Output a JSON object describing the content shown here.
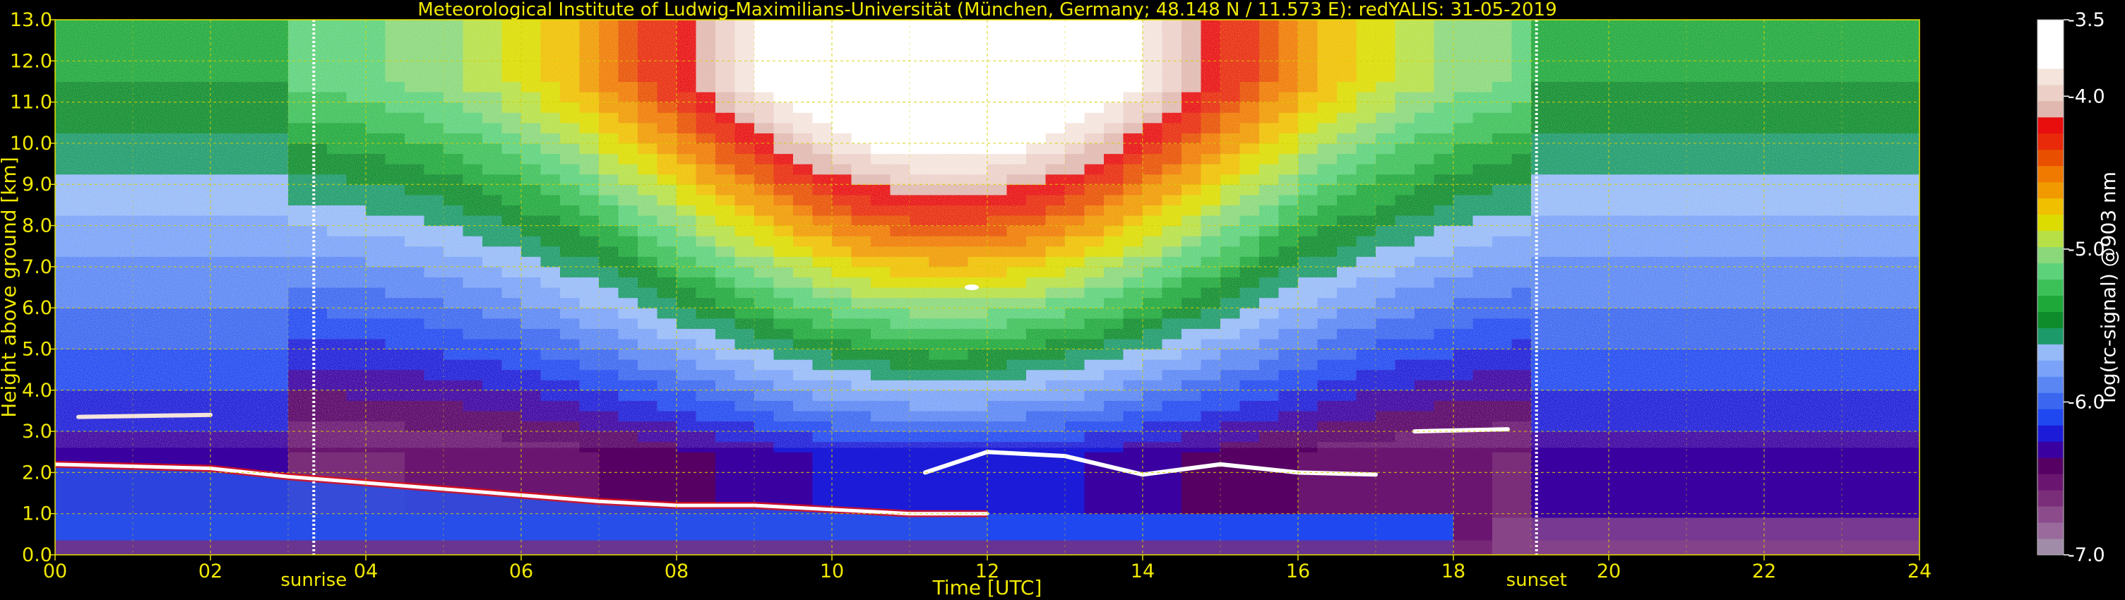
{
  "chart_data": {
    "type": "heatmap",
    "title": "Meteorological Institute of Ludwig-Maximilians-Universität (München, Germany; 48.148 N / 11.573 E):    redYALIS: 31-05-2019",
    "xlabel": "Time [UTC]",
    "ylabel": "Height above ground [km]",
    "xlim": [
      0,
      24
    ],
    "ylim": [
      0,
      13
    ],
    "xticks": [
      {
        "value": 0,
        "label": "00"
      },
      {
        "value": 2,
        "label": "02"
      },
      {
        "value": 4,
        "label": "04"
      },
      {
        "value": 6,
        "label": "06"
      },
      {
        "value": 8,
        "label": "08"
      },
      {
        "value": 10,
        "label": "10"
      },
      {
        "value": 12,
        "label": "12"
      },
      {
        "value": 14,
        "label": "14"
      },
      {
        "value": 16,
        "label": "16"
      },
      {
        "value": 18,
        "label": "18"
      },
      {
        "value": 20,
        "label": "20"
      },
      {
        "value": 22,
        "label": "22"
      },
      {
        "value": 24,
        "label": "24"
      }
    ],
    "yticks": [
      {
        "value": 0,
        "label": "0.0"
      },
      {
        "value": 1,
        "label": "1.0"
      },
      {
        "value": 2,
        "label": "2.0"
      },
      {
        "value": 3,
        "label": "3.0"
      },
      {
        "value": 4,
        "label": "4.0"
      },
      {
        "value": 5,
        "label": "5.0"
      },
      {
        "value": 6,
        "label": "6.0"
      },
      {
        "value": 7,
        "label": "7.0"
      },
      {
        "value": 8,
        "label": "8.0"
      },
      {
        "value": 9,
        "label": "9.0"
      },
      {
        "value": 10,
        "label": "10.0"
      },
      {
        "value": 11,
        "label": "11.0"
      },
      {
        "value": 12,
        "label": "12.0"
      },
      {
        "value": 13,
        "label": "13.0"
      }
    ],
    "grid": true,
    "markers": [
      {
        "label": "sunrise",
        "x": 3.33
      },
      {
        "label": "sunset",
        "x": 19.07
      }
    ],
    "colorbar": {
      "label": "log(rc-signal) @903 nm",
      "range": [
        -7.0,
        -3.5
      ],
      "ticks": [
        {
          "value": -3.5,
          "label": "-3.5"
        },
        {
          "value": -4.0,
          "label": "-4.0"
        },
        {
          "value": -5.0,
          "label": "-5.0"
        },
        {
          "value": -6.0,
          "label": "-6.0"
        },
        {
          "value": -7.0,
          "label": "-7.0"
        }
      ],
      "colors": [
        "#a08ca8",
        "#9a6a9c",
        "#8c4c8c",
        "#7a2e7a",
        "#6a1670",
        "#560064",
        "#3a00a0",
        "#1c1cd8",
        "#2048f0",
        "#3a66f0",
        "#5a86f4",
        "#7aa2f8",
        "#96baf8",
        "#1c9a6a",
        "#0e8c2c",
        "#1ea83a",
        "#3cc058",
        "#5cd27a",
        "#8ad87a",
        "#b6e046",
        "#dcdc00",
        "#f0c000",
        "#f09a00",
        "#f07a00",
        "#e85000",
        "#e82a0a",
        "#e80e0e",
        "#e0b8b0",
        "#ecd0c8",
        "#f4e4dc",
        "#ffffff",
        "#ffffff",
        "#ffffff"
      ]
    },
    "features": [
      {
        "label": "boundary-layer top",
        "points": [
          [
            0,
            2.2
          ],
          [
            1,
            2.15
          ],
          [
            2,
            2.1
          ],
          [
            3,
            1.9
          ],
          [
            4,
            1.75
          ],
          [
            5,
            1.6
          ],
          [
            6,
            1.45
          ],
          [
            7,
            1.3
          ],
          [
            8,
            1.2
          ],
          [
            9,
            1.2
          ],
          [
            10,
            1.1
          ],
          [
            11,
            1.0
          ],
          [
            12,
            1.0
          ]
        ]
      },
      {
        "label": "cloud layer afternoon",
        "points": [
          [
            11.2,
            2.0
          ],
          [
            12,
            2.5
          ],
          [
            13,
            2.4
          ],
          [
            14,
            1.95
          ],
          [
            15,
            2.2
          ],
          [
            16,
            2.0
          ],
          [
            17,
            1.95
          ]
        ]
      },
      {
        "label": "elevated cloud evening",
        "points": [
          [
            17.5,
            3.0
          ],
          [
            18.7,
            3.05
          ]
        ]
      },
      {
        "label": "elevated aerosol night",
        "points": [
          [
            0.3,
            3.35
          ],
          [
            2,
            3.4
          ]
        ]
      },
      {
        "label": "small cloud midday",
        "points": [
          [
            11.8,
            6.5
          ]
        ]
      }
    ]
  }
}
